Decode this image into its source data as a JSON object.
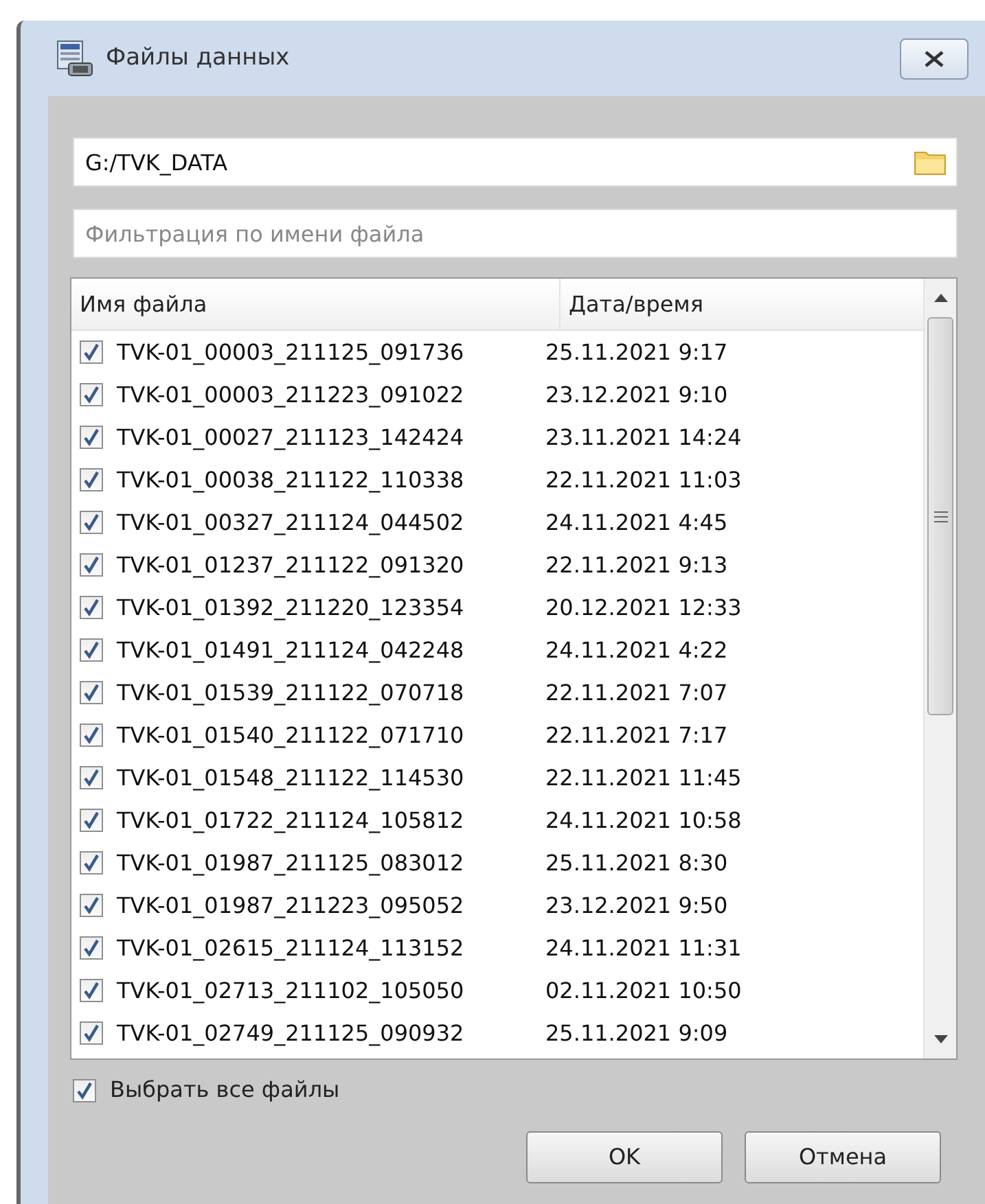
{
  "window": {
    "title": "Файлы данных"
  },
  "path_field": {
    "value": "G:/TVK_DATA"
  },
  "filter_field": {
    "placeholder": "Фильтрация по имени файла"
  },
  "table": {
    "columns": [
      "Имя файла",
      "Дата/время"
    ],
    "rows": [
      {
        "name": "TVK-01_00003_211125_091736",
        "datetime": "25.11.2021 9:17",
        "checked": true
      },
      {
        "name": "TVK-01_00003_211223_091022",
        "datetime": "23.12.2021 9:10",
        "checked": true
      },
      {
        "name": "TVK-01_00027_211123_142424",
        "datetime": "23.11.2021 14:24",
        "checked": true
      },
      {
        "name": "TVK-01_00038_211122_110338",
        "datetime": "22.11.2021 11:03",
        "checked": true
      },
      {
        "name": "TVK-01_00327_211124_044502",
        "datetime": "24.11.2021 4:45",
        "checked": true
      },
      {
        "name": "TVK-01_01237_211122_091320",
        "datetime": "22.11.2021 9:13",
        "checked": true
      },
      {
        "name": "TVK-01_01392_211220_123354",
        "datetime": "20.12.2021 12:33",
        "checked": true
      },
      {
        "name": "TVK-01_01491_211124_042248",
        "datetime": "24.11.2021 4:22",
        "checked": true
      },
      {
        "name": "TVK-01_01539_211122_070718",
        "datetime": "22.11.2021 7:07",
        "checked": true
      },
      {
        "name": "TVK-01_01540_211122_071710",
        "datetime": "22.11.2021 7:17",
        "checked": true
      },
      {
        "name": "TVK-01_01548_211122_114530",
        "datetime": "22.11.2021 11:45",
        "checked": true
      },
      {
        "name": "TVK-01_01722_211124_105812",
        "datetime": "24.11.2021 10:58",
        "checked": true
      },
      {
        "name": "TVK-01_01987_211125_083012",
        "datetime": "25.11.2021 8:30",
        "checked": true
      },
      {
        "name": "TVK-01_01987_211223_095052",
        "datetime": "23.12.2021 9:50",
        "checked": true
      },
      {
        "name": "TVK-01_02615_211124_113152",
        "datetime": "24.11.2021 11:31",
        "checked": true
      },
      {
        "name": "TVK-01_02713_211102_105050",
        "datetime": "02.11.2021 10:50",
        "checked": true
      },
      {
        "name": "TVK-01_02749_211125_090932",
        "datetime": "25.11.2021 9:09",
        "checked": true
      }
    ]
  },
  "select_all": {
    "label": "Выбрать все файлы",
    "checked": true
  },
  "buttons": [
    "OK",
    "Отмена"
  ]
}
